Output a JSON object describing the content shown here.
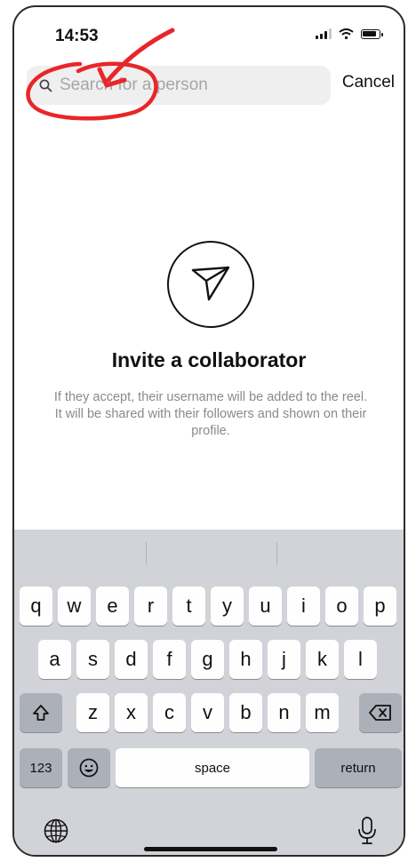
{
  "status_bar": {
    "time": "14:53"
  },
  "search": {
    "placeholder": "Search for a person",
    "value": "",
    "cancel_label": "Cancel"
  },
  "empty_state": {
    "title": "Invite a collaborator",
    "description": "If they accept, their username will be added to the reel. It will be shared with their followers and shown on their profile."
  },
  "keyboard": {
    "row1": [
      "q",
      "w",
      "e",
      "r",
      "t",
      "y",
      "u",
      "i",
      "o",
      "p"
    ],
    "row2": [
      "a",
      "s",
      "d",
      "f",
      "g",
      "h",
      "j",
      "k",
      "l"
    ],
    "row3": [
      "z",
      "x",
      "c",
      "v",
      "b",
      "n",
      "m"
    ],
    "numbers_label": "123",
    "space_label": "space",
    "return_label": "return"
  },
  "icons": {
    "search": "search-icon",
    "send": "paper-plane-icon",
    "shift": "shift-icon",
    "backspace": "backspace-icon",
    "emoji": "emoji-icon",
    "globe": "globe-icon",
    "microphone": "microphone-icon",
    "wifi": "wifi-icon",
    "battery": "battery-icon",
    "signal": "signal-icon"
  },
  "colors": {
    "annotation": "#e8262a",
    "keyboard_bg": "#d2d3d8",
    "search_bg": "#efefef"
  }
}
